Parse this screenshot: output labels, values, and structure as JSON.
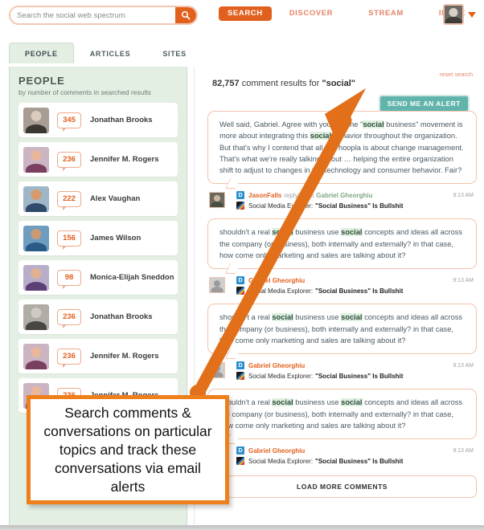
{
  "header": {
    "search": {
      "placeholder": "Search the social web spectrum",
      "value": "",
      "icon": "search-icon"
    },
    "nav": [
      {
        "label": "SEARCH",
        "active": true
      },
      {
        "label": "DISCOVER",
        "active": false
      },
      {
        "label": "STREAM",
        "active": false
      },
      {
        "label": "INBOX",
        "active": false
      }
    ],
    "account": {
      "avatar_icon": "user-avatar",
      "caret_icon": "chevron-down-icon"
    }
  },
  "tabs": [
    {
      "label": "PEOPLE",
      "active": true
    },
    {
      "label": "ARTICLES",
      "active": false
    },
    {
      "label": "SITES",
      "active": false
    }
  ],
  "sidebar": {
    "title": "PEOPLE",
    "subtitle": "by number of comments in searched results",
    "people": [
      {
        "count": "345",
        "name": "Jonathan Brooks",
        "face": "#d9cbbd",
        "body": "#3b3733",
        "bg": "#a89d92"
      },
      {
        "count": "236",
        "name": "Jennifer M. Rogers",
        "face": "#e8b79c",
        "body": "#7a3f5e",
        "bg": "#cbb5c3"
      },
      {
        "count": "222",
        "name": "Alex Vaughan",
        "face": "#d79a6d",
        "body": "#2f4a6b",
        "bg": "#9fb6c6"
      },
      {
        "count": "156",
        "name": "James Wilson",
        "face": "#c99a74",
        "body": "#2a5a86",
        "bg": "#6f9dc0"
      },
      {
        "count": "98",
        "name": "Monica-Elijah Sneddon",
        "face": "#e0b193",
        "body": "#5c3f74",
        "bg": "#b9aec9"
      },
      {
        "count": "236",
        "name": "Jonathan Brooks",
        "face": "#cfcac5",
        "body": "#4a4643",
        "bg": "#b0aca6"
      },
      {
        "count": "236",
        "name": "Jennifer M. Rogers",
        "face": "#e8b79c",
        "body": "#7a3f5e",
        "bg": "#cbb5c3"
      },
      {
        "count": "236",
        "name": "Jennifer M. Rogers",
        "face": "#e8b79c",
        "body": "#7a3f5e",
        "bg": "#cbb5c3"
      }
    ]
  },
  "main": {
    "reset_search_label": "reset search",
    "results_count": "82,757",
    "results_text_mid": " comment results for ",
    "results_term": "\"social\"",
    "alert_button_label": "SEND ME AN ALERT",
    "load_more_label": "LOAD MORE COMMENTS",
    "comments": [
      {
        "text_parts": [
          {
            "t": "Well said, Gabriel. Agree with you that the \"",
            "s": "n"
          },
          {
            "t": "social",
            "s": "h"
          },
          {
            "t": " business\" movement is more about integrating this ",
            "s": "n"
          },
          {
            "t": "social",
            "s": "h"
          },
          {
            "t": " behavior throughout the organization. But that's why I contend that all this hoopla is about change management. That's what we're really talking about … helping the entire organization shift to adjust to changes in the technology and consumer behavior. Fair?",
            "s": "n"
          }
        ],
        "author": "JasonFalls",
        "reply_label": "replying to",
        "reply_target": "Gabriel Gheorghiu",
        "time": "9:13 AM",
        "site_name": "Social Media Explorer:",
        "site_title": "\"Social Business\" Is Bullshit",
        "avatar_kind": "photo"
      },
      {
        "text_parts": [
          {
            "t": "shouldn't a real ",
            "s": "n"
          },
          {
            "t": "social",
            "s": "h"
          },
          {
            "t": " business use ",
            "s": "n"
          },
          {
            "t": "social",
            "s": "h"
          },
          {
            "t": " concepts and ideas all across the company (or business), both internally and externally? in that case, how come only marketing and sales are talking about it?",
            "s": "n"
          }
        ],
        "author": "Gabriel Gheorghiu",
        "reply_label": "",
        "reply_target": "",
        "time": "9:13 AM",
        "site_name": "Social Media Explorer:",
        "site_title": "\"Social Business\" Is Bullshit",
        "avatar_kind": "blank"
      },
      {
        "text_parts": [
          {
            "t": "shouldn't a real ",
            "s": "n"
          },
          {
            "t": "social",
            "s": "h"
          },
          {
            "t": " business use ",
            "s": "n"
          },
          {
            "t": "social",
            "s": "h"
          },
          {
            "t": " concepts and ideas all across the company (or business), both internally and externally? in that case, how come only marketing and sales are talking about it?",
            "s": "n"
          }
        ],
        "author": "Gabriel Gheorghiu",
        "reply_label": "",
        "reply_target": "",
        "time": "9:13 AM",
        "site_name": "Social Media Explorer:",
        "site_title": "\"Social Business\" Is Bullshit",
        "avatar_kind": "blank"
      },
      {
        "text_parts": [
          {
            "t": "shouldn't a real ",
            "s": "n"
          },
          {
            "t": "social",
            "s": "h"
          },
          {
            "t": " business use ",
            "s": "n"
          },
          {
            "t": "social",
            "s": "h"
          },
          {
            "t": " concepts and ideas all across the company (or business), both internally and externally? in that case, how come only marketing and sales are talking about it?",
            "s": "n"
          }
        ],
        "author": "Gabriel Gheorghiu",
        "reply_label": "",
        "reply_target": "",
        "time": "9:13 AM",
        "site_name": "Social Media Explorer:",
        "site_title": "\"Social Business\" Is Bullshit",
        "avatar_kind": "blank"
      }
    ]
  },
  "annotation": {
    "callout_text": "Search comments & conversations on particular topics and track these conversations via email alerts",
    "arrow_color": "#e2701a"
  },
  "colors": {
    "accent_orange": "#e2601e",
    "annotation_orange": "#ef7f1a",
    "teal": "#60b4ab",
    "sidebar_green": "#e4efe4",
    "highlight_green": "#ddf0dd"
  }
}
